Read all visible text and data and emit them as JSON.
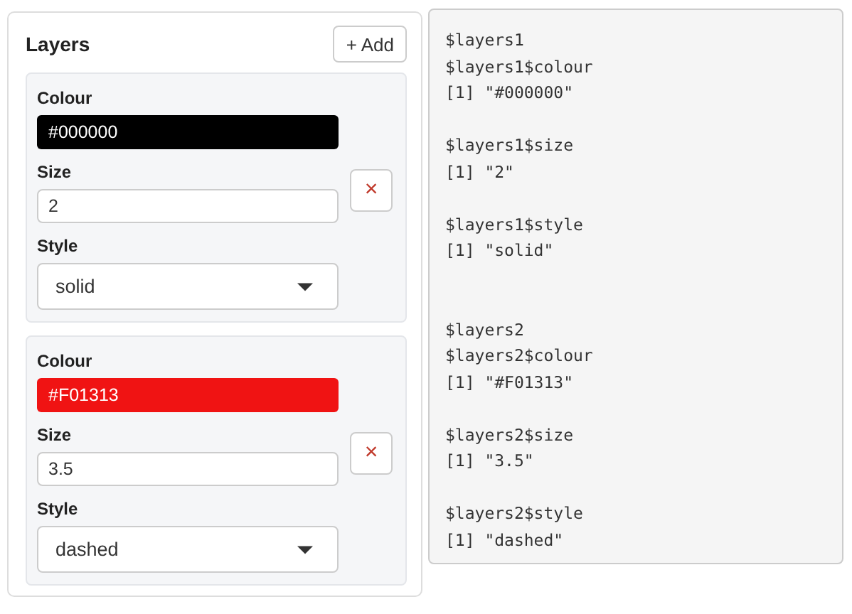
{
  "layers_panel": {
    "title": "Layers",
    "add_button": "+ Add",
    "layers": [
      {
        "colour_label": "Colour",
        "colour_value": "#000000",
        "color": "#000000",
        "size_label": "Size",
        "size_value": "2",
        "remove_button": "×",
        "style_label": "Style",
        "style_value": "solid"
      },
      {
        "colour_label": "Colour",
        "colour_value": "#F01313",
        "color": "#f01313",
        "size_label": "Size",
        "size_value": "3.5",
        "remove_button": "×",
        "style_label": "Style",
        "style_value": "dashed"
      }
    ]
  },
  "output": {
    "blocks": [
      {
        "kind": "layer",
        "lines": [
          "$layers1",
          "$layers1$colour",
          "[1] \"#000000\""
        ]
      },
      {
        "kind": "field",
        "lines": [
          "$layers1$size",
          "[1] \"2\""
        ]
      },
      {
        "kind": "field",
        "lines": [
          "$layers1$style",
          "[1] \"solid\""
        ]
      },
      {
        "kind": "layer",
        "lines": [
          "$layers2",
          "$layers2$colour",
          "[1] \"#F01313\""
        ]
      },
      {
        "kind": "field",
        "lines": [
          "$layers2$size",
          "[1] \"3.5\""
        ]
      },
      {
        "kind": "field",
        "lines": [
          "$layers2$style",
          "[1] \"dashed\""
        ]
      }
    ]
  }
}
